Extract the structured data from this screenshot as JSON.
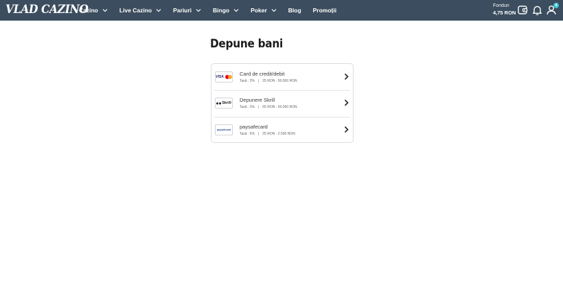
{
  "header": {
    "logo": "VLAD CAZINO",
    "nav": [
      {
        "label": "Cazino",
        "has_dropdown": true
      },
      {
        "label": "Live Cazino",
        "has_dropdown": true
      },
      {
        "label": "Pariuri",
        "has_dropdown": true
      },
      {
        "label": "Bingo",
        "has_dropdown": true
      },
      {
        "label": "Poker",
        "has_dropdown": true
      },
      {
        "label": "Blog",
        "has_dropdown": false
      },
      {
        "label": "Promoții",
        "has_dropdown": false
      }
    ],
    "funds_label": "Fonduri",
    "funds_value": "4,75 RON",
    "icons": [
      "wallet-icon",
      "bell-icon",
      "user-icon"
    ],
    "user_badge": "4"
  },
  "main": {
    "title": "Depune bani",
    "methods": [
      {
        "name": "Card de credit/debit",
        "fee": "Taxă : 2%",
        "limits": "25 RON - 50.000 RON",
        "logo": "visa-mastercard"
      },
      {
        "name": "Depunere Skrill",
        "fee": "Taxă : 2%",
        "limits": "65 RON - 50.000 RON",
        "logo": "skrill"
      },
      {
        "name": "paysafecard",
        "fee": "Taxă : 5%",
        "limits": "25 RON - 2.500 RON",
        "logo": "paysafecard"
      }
    ],
    "logo_texts": {
      "visa": "VISA",
      "skrill": "Skrill",
      "psc": "paysafecard"
    }
  },
  "colors": {
    "header_bg": "#3b4d5e",
    "badge": "#39c6d6",
    "border": "#d9dce0"
  }
}
